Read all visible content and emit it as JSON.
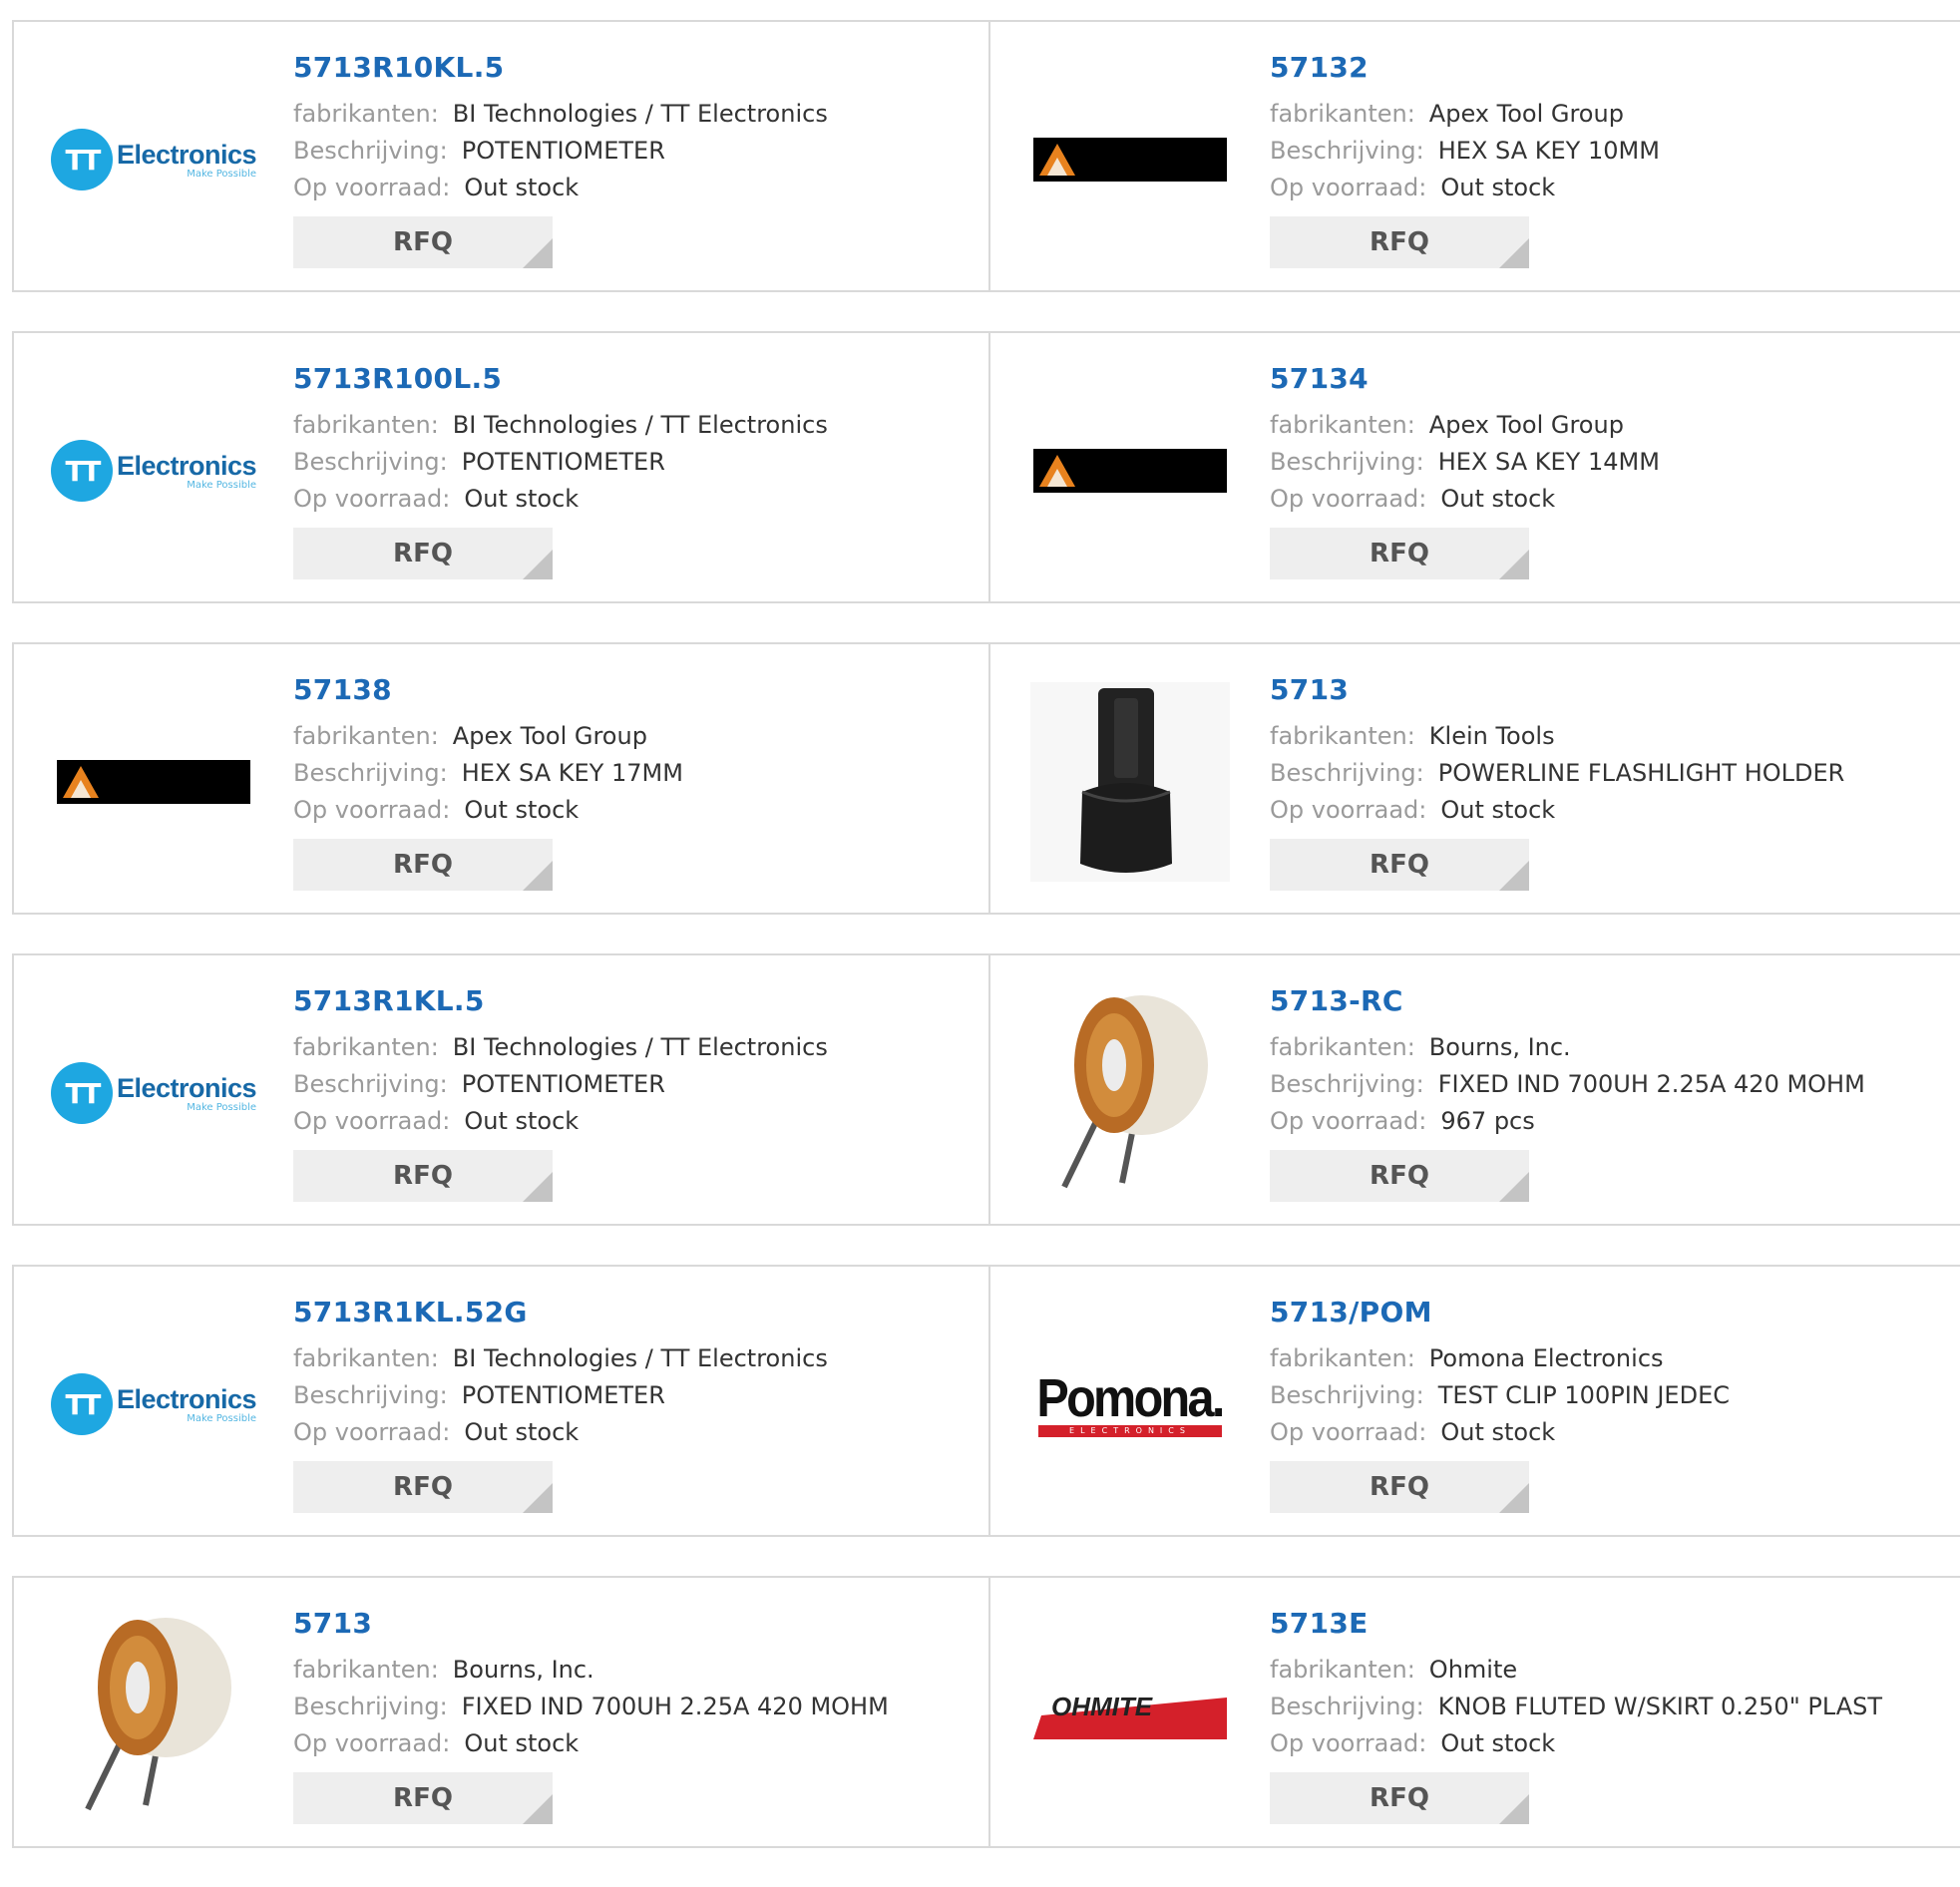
{
  "labels": {
    "manufacturer": "fabrikanten:",
    "description": "Beschrijving:",
    "stock": "Op voorraad:",
    "rfq": "RFQ"
  },
  "products": [
    {
      "part": "5713R10KL.5",
      "manufacturer": "BI Technologies / TT Electronics",
      "description": "POTENTIOMETER",
      "stock": "Out stock",
      "logo": "tt-electronics-logo"
    },
    {
      "part": "57132",
      "manufacturer": "Apex Tool Group",
      "description": "HEX SA KEY 10MM",
      "stock": "Out stock",
      "logo": "apex-logo"
    },
    {
      "part": "5713R100L.5",
      "manufacturer": "BI Technologies / TT Electronics",
      "description": "POTENTIOMETER",
      "stock": "Out stock",
      "logo": "tt-electronics-logo"
    },
    {
      "part": "57134",
      "manufacturer": "Apex Tool Group",
      "description": "HEX SA KEY 14MM",
      "stock": "Out stock",
      "logo": "apex-logo"
    },
    {
      "part": "57138",
      "manufacturer": "Apex Tool Group",
      "description": "HEX SA KEY 17MM",
      "stock": "Out stock",
      "logo": "apex-logo"
    },
    {
      "part": "5713",
      "manufacturer": "Klein Tools",
      "description": "POWERLINE FLASHLIGHT HOLDER",
      "stock": "Out stock",
      "logo": "flashlight-holder-image"
    },
    {
      "part": "5713R1KL.5",
      "manufacturer": "BI Technologies / TT Electronics",
      "description": "POTENTIOMETER",
      "stock": "Out stock",
      "logo": "tt-electronics-logo"
    },
    {
      "part": "5713-RC",
      "manufacturer": "Bourns, Inc.",
      "description": "FIXED IND 700UH 2.25A 420 MOHM",
      "stock": "967 pcs",
      "logo": "toroid-inductor-image"
    },
    {
      "part": "5713R1KL.52G",
      "manufacturer": "BI Technologies / TT Electronics",
      "description": "POTENTIOMETER",
      "stock": "Out stock",
      "logo": "tt-electronics-logo"
    },
    {
      "part": "5713/POM",
      "manufacturer": "Pomona Electronics",
      "description": "TEST CLIP 100PIN JEDEC",
      "stock": "Out stock",
      "logo": "pomona-logo"
    },
    {
      "part": "5713",
      "manufacturer": "Bourns, Inc.",
      "description": "FIXED IND 700UH 2.25A 420 MOHM",
      "stock": "Out stock",
      "logo": "toroid-inductor-image"
    },
    {
      "part": "5713E",
      "manufacturer": "Ohmite",
      "description": "KNOB FLUTED W/SKIRT 0.250\" PLAST",
      "stock": "Out stock",
      "logo": "ohmite-logo"
    }
  ],
  "logo_text": {
    "tt": "Electronics",
    "tt_sub": "Make Possible",
    "tt_mark": "TT",
    "pomona": "Pomona.",
    "pomona_sub": "ELECTRONICS",
    "ohmite": "OHMITE"
  },
  "colors": {
    "part_link": "#1c69b5",
    "tt_blue": "#1ea7e1",
    "pomona_red": "#d4202a",
    "ohmite_red": "#d4202a"
  }
}
